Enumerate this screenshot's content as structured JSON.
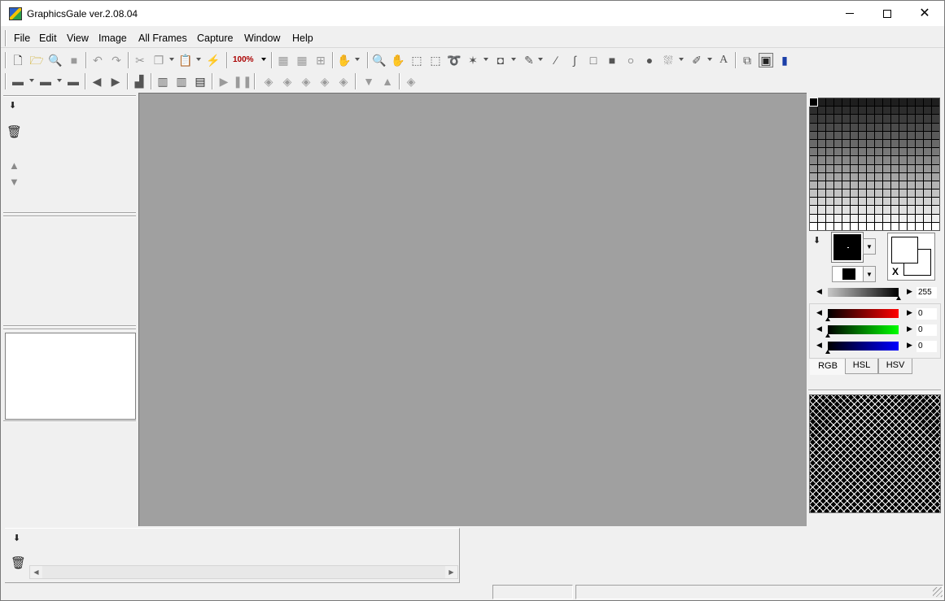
{
  "window": {
    "title": "GraphicsGale ver.2.08.04",
    "controls": {
      "minimize": "minimize",
      "maximize": "maximize",
      "close": "✕"
    }
  },
  "menu": {
    "items": [
      "File",
      "Edit",
      "View",
      "Image",
      "All Frames",
      "Capture",
      "Window",
      "Help"
    ]
  },
  "toolbar1": {
    "zoom": "100%",
    "icons": [
      "new-file-icon",
      "open-folder-icon",
      "magnifier-icon",
      "stop-icon",
      "undo-icon",
      "redo-icon",
      "cut-icon",
      "copy-icon",
      "paste-icon",
      "paste-special-icon",
      "zoom-dropdown",
      "grid-icon",
      "fine-grid-icon",
      "grid-settings-icon",
      "palette-tools-icon",
      "zoom-tool-icon",
      "hand-icon",
      "rect-select-icon",
      "free-select-icon",
      "lasso-icon",
      "magic-wand-icon",
      "stamp-icon",
      "dropper-icon",
      "line-icon",
      "curve-icon",
      "rect-icon",
      "filled-rect-icon",
      "ellipse-icon",
      "filled-ellipse-icon",
      "fill-icon",
      "brush-icon",
      "text-icon",
      "frames-icon",
      "window-icon",
      "pen-icon"
    ]
  },
  "toolbar2": {
    "icons": [
      "frame-new-icon",
      "frame-copy-icon",
      "frame-delete-icon",
      "prev-frame-icon",
      "next-frame-icon",
      "frame-settings-icon",
      "frame-cut-icon",
      "frame-copy2-icon",
      "frame-paste-icon",
      "play-icon",
      "pause-icon",
      "layer-new-icon",
      "layer-merge-icon",
      "layer-delete-icon",
      "layer-add-icon",
      "layer-dup-icon",
      "layer-down-icon",
      "layer-up-icon",
      "layer-settings-icon"
    ]
  },
  "color_panel": {
    "alpha_value": "255",
    "rgb": {
      "r": "0",
      "g": "0",
      "b": "0"
    },
    "tabs": [
      "RGB",
      "HSL",
      "HSV"
    ],
    "active_tab": "RGB",
    "swap_label": "X",
    "foreground_color": "#000000",
    "background_color": "#ffffff",
    "slider_levels": {
      "alpha": 1.0,
      "r": 0,
      "g": 0,
      "b": 0
    }
  },
  "colors": {
    "canvas_bg": "#a0a0a0",
    "red_bar": "#ff0000",
    "green_bar": "#00ff00",
    "blue_bar": "#0000ff"
  },
  "status": {
    "pane1": "",
    "pane2": ""
  }
}
